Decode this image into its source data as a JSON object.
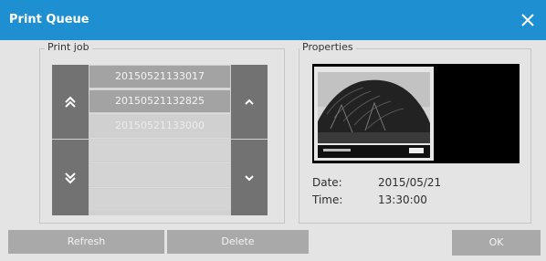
{
  "window": {
    "title": "Print Queue",
    "accent_color": "#1e90d2",
    "close_icon": "close-icon"
  },
  "print_job": {
    "label": "Print job",
    "jobs": [
      {
        "name": "20150521133017",
        "state": "normal"
      },
      {
        "name": "20150521132825",
        "state": "normal"
      },
      {
        "name": "20150521133000",
        "state": "faded"
      }
    ],
    "nav_icons": {
      "first": "double-chevron-up-icon",
      "last": "double-chevron-down-icon",
      "up": "chevron-up-icon",
      "down": "chevron-down-icon"
    }
  },
  "properties": {
    "label": "Properties",
    "date_label": "Date:",
    "date_value": "2015/05/21",
    "time_label": "Time:",
    "time_value": "13:30:00"
  },
  "buttons": {
    "refresh": "Refresh",
    "delete": "Delete",
    "ok": "OK"
  }
}
